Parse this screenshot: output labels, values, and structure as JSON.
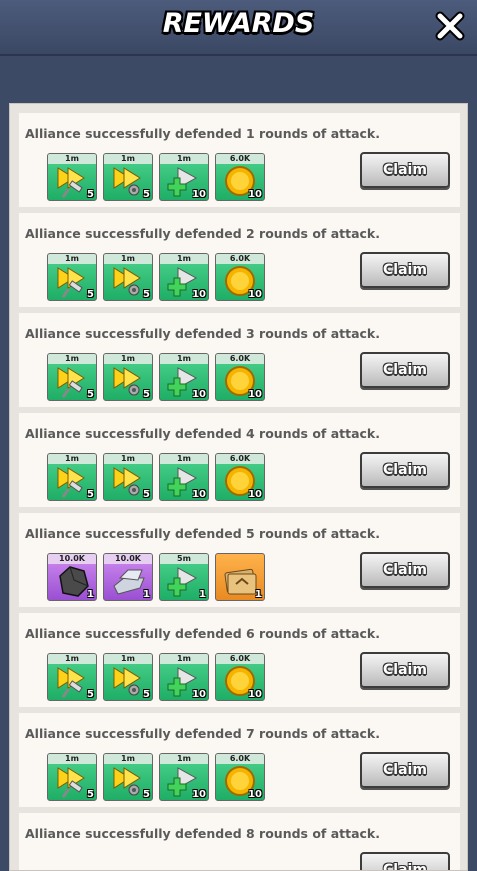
{
  "header": {
    "title": "REWARDS"
  },
  "colors": {
    "header": "#3b4864",
    "item_green": "#2cbf73",
    "item_purple": "#b56ae1",
    "item_orange": "#f59b35",
    "claim_button": "#d0d0d0"
  },
  "claim_label": "Claim",
  "rows": [
    {
      "text": "Alliance successfully defended 1 rounds of attack.",
      "items": [
        {
          "icon": "speedup-build-icon",
          "tag": "1m",
          "qty": "5",
          "color": "green"
        },
        {
          "icon": "speedup-research-icon",
          "tag": "1m",
          "qty": "5",
          "color": "green"
        },
        {
          "icon": "speedup-heal-icon",
          "tag": "1m",
          "qty": "10",
          "color": "green"
        },
        {
          "icon": "gold-coin-icon",
          "tag": "6.0K",
          "qty": "10",
          "color": "green"
        }
      ]
    },
    {
      "text": "Alliance successfully defended 2 rounds of attack.",
      "items": [
        {
          "icon": "speedup-build-icon",
          "tag": "1m",
          "qty": "5",
          "color": "green"
        },
        {
          "icon": "speedup-research-icon",
          "tag": "1m",
          "qty": "5",
          "color": "green"
        },
        {
          "icon": "speedup-heal-icon",
          "tag": "1m",
          "qty": "10",
          "color": "green"
        },
        {
          "icon": "gold-coin-icon",
          "tag": "6.0K",
          "qty": "10",
          "color": "green"
        }
      ]
    },
    {
      "text": "Alliance successfully defended 3 rounds of attack.",
      "items": [
        {
          "icon": "speedup-build-icon",
          "tag": "1m",
          "qty": "5",
          "color": "green"
        },
        {
          "icon": "speedup-research-icon",
          "tag": "1m",
          "qty": "5",
          "color": "green"
        },
        {
          "icon": "speedup-heal-icon",
          "tag": "1m",
          "qty": "10",
          "color": "green"
        },
        {
          "icon": "gold-coin-icon",
          "tag": "6.0K",
          "qty": "10",
          "color": "green"
        }
      ]
    },
    {
      "text": "Alliance successfully defended 4 rounds of attack.",
      "items": [
        {
          "icon": "speedup-build-icon",
          "tag": "1m",
          "qty": "5",
          "color": "green"
        },
        {
          "icon": "speedup-research-icon",
          "tag": "1m",
          "qty": "5",
          "color": "green"
        },
        {
          "icon": "speedup-heal-icon",
          "tag": "1m",
          "qty": "10",
          "color": "green"
        },
        {
          "icon": "gold-coin-icon",
          "tag": "6.0K",
          "qty": "10",
          "color": "green"
        }
      ]
    },
    {
      "text": "Alliance successfully defended 5 rounds of attack.",
      "items": [
        {
          "icon": "stone-ore-icon",
          "tag": "10.0K",
          "qty": "1",
          "color": "purple"
        },
        {
          "icon": "iron-ingot-icon",
          "tag": "10.0K",
          "qty": "1",
          "color": "purple"
        },
        {
          "icon": "speedup-heal-icon",
          "tag": "5m",
          "qty": "1",
          "color": "green"
        },
        {
          "icon": "card-pack-icon",
          "tag": "",
          "qty": "1",
          "color": "orange"
        }
      ]
    },
    {
      "text": "Alliance successfully defended 6 rounds of attack.",
      "items": [
        {
          "icon": "speedup-build-icon",
          "tag": "1m",
          "qty": "5",
          "color": "green"
        },
        {
          "icon": "speedup-research-icon",
          "tag": "1m",
          "qty": "5",
          "color": "green"
        },
        {
          "icon": "speedup-heal-icon",
          "tag": "1m",
          "qty": "10",
          "color": "green"
        },
        {
          "icon": "gold-coin-icon",
          "tag": "6.0K",
          "qty": "10",
          "color": "green"
        }
      ]
    },
    {
      "text": "Alliance successfully defended 7 rounds of attack.",
      "items": [
        {
          "icon": "speedup-build-icon",
          "tag": "1m",
          "qty": "5",
          "color": "green"
        },
        {
          "icon": "speedup-research-icon",
          "tag": "1m",
          "qty": "5",
          "color": "green"
        },
        {
          "icon": "speedup-heal-icon",
          "tag": "1m",
          "qty": "10",
          "color": "green"
        },
        {
          "icon": "gold-coin-icon",
          "tag": "6.0K",
          "qty": "10",
          "color": "green"
        }
      ]
    },
    {
      "text": "Alliance successfully defended 8 rounds of attack.",
      "items": []
    }
  ]
}
